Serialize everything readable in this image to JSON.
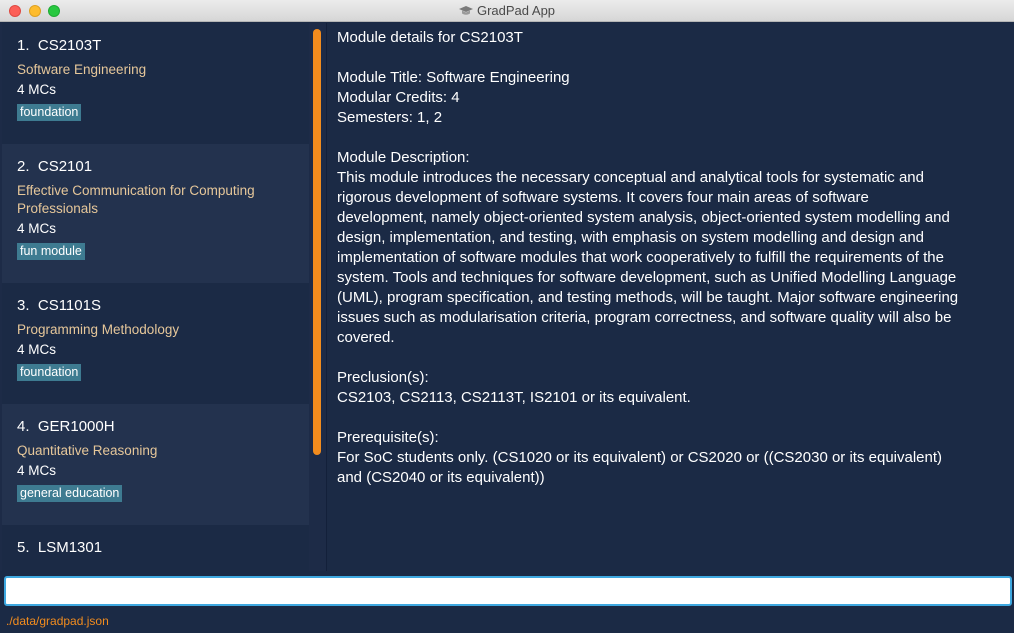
{
  "window": {
    "title": "GradPad App"
  },
  "modules": [
    {
      "index": "1.",
      "code": "CS2103T",
      "title": "Software Engineering",
      "mcs": "4 MCs",
      "tag": "foundation"
    },
    {
      "index": "2.",
      "code": "CS2101",
      "title": "Effective Communication for Computing Professionals",
      "mcs": "4 MCs",
      "tag": "fun module"
    },
    {
      "index": "3.",
      "code": "CS1101S",
      "title": "Programming Methodology",
      "mcs": "4 MCs",
      "tag": "foundation"
    },
    {
      "index": "4.",
      "code": "GER1000H",
      "title": "Quantitative Reasoning",
      "mcs": "4 MCs",
      "tag": "general education"
    },
    {
      "index": "5.",
      "code": "LSM1301"
    }
  ],
  "details": {
    "header": "Module details for CS2103T",
    "title_line": "Module Title: Software Engineering",
    "credits_line": "Modular Credits: 4",
    "semesters_line": "Semesters: 1, 2",
    "description_label": "Module Description:",
    "description_lines": [
      "This module introduces the necessary conceptual and analytical tools for systematic and",
      "rigorous development of software systems. It covers four main areas of software",
      "development, namely object-oriented system analysis, object-oriented system modelling and",
      "design, implementation, and testing, with emphasis on system modelling and design and",
      "implementation of software modules that work cooperatively to fulfill the requirements of the",
      "system. Tools and techniques for software development, such as Unified Modelling Language",
      "(UML), program specification, and testing methods, will be taught. Major software engineering",
      "issues such as modularisation criteria, program correctness, and software quality will also be",
      "covered."
    ],
    "preclusion_label": "Preclusion(s):",
    "preclusion_value": "CS2103, CS2113, CS2113T, IS2101 or its equivalent.",
    "prereq_label": "Prerequisite(s):",
    "prereq_lines": [
      "For SoC students only. (CS1020 or its equivalent) or CS2020 or ((CS2030 or its equivalent)",
      "and (CS2040 or its equivalent))"
    ]
  },
  "command": {
    "value": "",
    "placeholder": ""
  },
  "status": {
    "path": "./data/gradpad.json"
  },
  "colors": {
    "background": "#1b2a45",
    "accent": "#f28c1e",
    "tag": "#3e7b91",
    "module_title": "#e6c79a",
    "input_border": "#3ea8e0"
  },
  "icons": {
    "app": "graduation-cap-icon"
  }
}
